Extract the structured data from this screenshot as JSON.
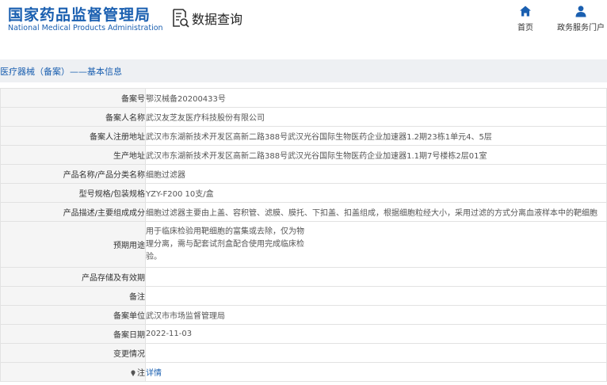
{
  "header": {
    "logo_cn": "国家药品监督管理局",
    "logo_en": "National Medical Products Administration",
    "title": "数据查询",
    "nav": [
      {
        "label": "首页",
        "icon": "home-icon"
      },
      {
        "label": "政务服务门户",
        "icon": "user-icon"
      }
    ]
  },
  "breadcrumb": "医疗器械（备案）——基本信息",
  "rows": [
    {
      "label": "备案号",
      "value": "鄂汉械备20200433号"
    },
    {
      "label": "备案人名称",
      "value": "武汉友芝友医疗科技股份有限公司"
    },
    {
      "label": "备案人注册地址",
      "value": "武汉市东湖新技术开发区高新二路388号武汉光谷国际生物医药企业加速器1.2期23栋1单元4、5层"
    },
    {
      "label": "生产地址",
      "value": "武汉市东湖新技术开发区高新二路388号武汉光谷国际生物医药企业加速器1.1期7号楼栋2层01室"
    },
    {
      "label": "产品名称/产品分类名称",
      "value": "细胞过滤器"
    },
    {
      "label": "型号规格/包装规格",
      "value": "YZY-F200 10支/盒"
    },
    {
      "label": "产品描述/主要组成成分",
      "value": "细胞过滤器主要由上盖、容积管、滤膜、膜托、下扣盖、扣盖组成，根据细胞粒经大小，采用过滤的方式分离血液样本中的靶细胞"
    },
    {
      "label": "预期用途",
      "value": "用于临床检验用靶细胞的富集或去除，仅为物理分离，需与配套试剂盒配合使用完成临床检验。"
    },
    {
      "label": "产品存储及有效期",
      "value": ""
    },
    {
      "label": "备注",
      "value": ""
    },
    {
      "label": "备案单位",
      "value": "武汉市市场监督管理局"
    },
    {
      "label": "备案日期",
      "value": "2022-11-03"
    },
    {
      "label": "变更情况",
      "value": ""
    },
    {
      "label": "注",
      "value": "详情"
    }
  ],
  "colors": {
    "brand": "#1a5fb0",
    "label_bg": "#f5f5f5",
    "crumb_bg": "#eef0f3",
    "border": "#e2e2e2"
  }
}
